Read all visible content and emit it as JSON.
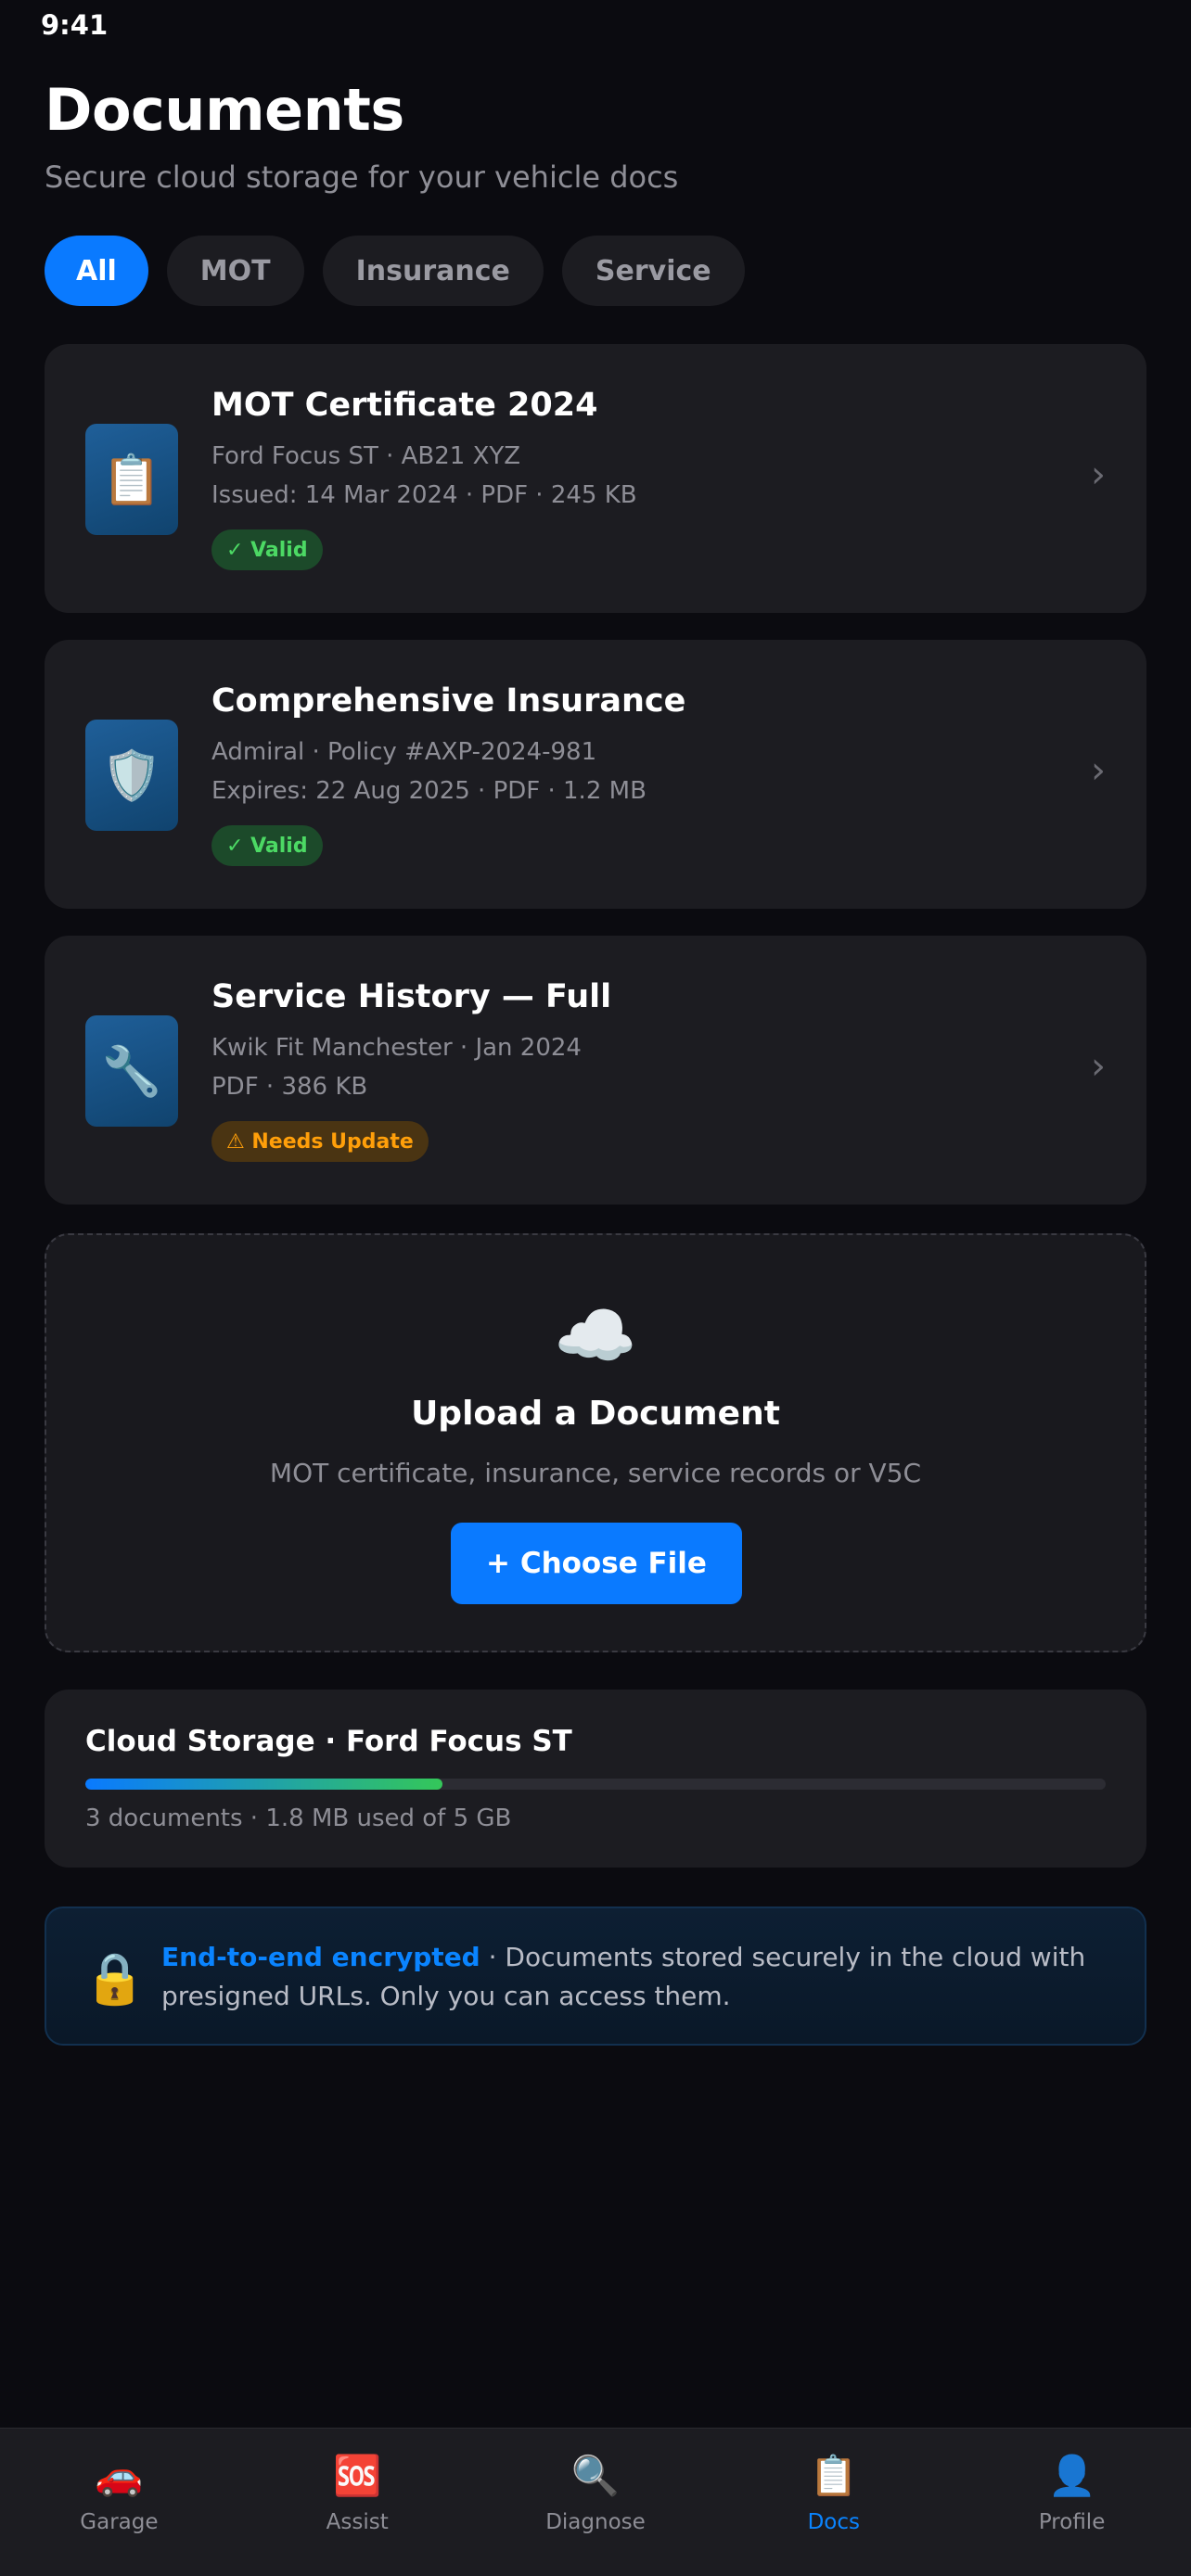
{
  "status_bar": {
    "time": "9:41"
  },
  "header": {
    "title": "Documents",
    "subtitle": "Secure cloud storage for your vehicle docs"
  },
  "filters": [
    {
      "label": "All",
      "active": true
    },
    {
      "label": "MOT",
      "active": false
    },
    {
      "label": "Insurance",
      "active": false
    },
    {
      "label": "Service",
      "active": false
    }
  ],
  "documents": [
    {
      "icon": "📋",
      "icon_name": "clipboard-icon",
      "title": "MOT Certificate 2024",
      "line1": "Ford Focus ST · AB21 XYZ",
      "line2": "Issued: 14 Mar 2024 · PDF · 245 KB",
      "badge": "✓ Valid",
      "badge_type": "valid"
    },
    {
      "icon": "🛡️",
      "icon_name": "shield-icon",
      "title": "Comprehensive Insurance",
      "line1": "Admiral · Policy #AXP-2024-981",
      "line2": "Expires: 22 Aug 2025 · PDF · 1.2 MB",
      "badge": "✓ Valid",
      "badge_type": "valid"
    },
    {
      "icon": "🔧",
      "icon_name": "wrench-icon",
      "title": "Service History — Full",
      "line1": "Kwik Fit Manchester · Jan 2024",
      "line2": "PDF · 386 KB",
      "badge": "⚠ Needs Update",
      "badge_type": "warn"
    }
  ],
  "chevron": "›",
  "upload": {
    "icon": "☁️",
    "title": "Upload a Document",
    "subtitle": "MOT certificate, insurance, service records or V5C",
    "button_label": "+ Choose File"
  },
  "storage": {
    "title": "Cloud Storage · Ford Focus ST",
    "summary": "3 documents · 1.8 MB used of 5 GB",
    "bar_fill_percent": 35
  },
  "security": {
    "icon": "🔒",
    "highlight": "End-to-end encrypted",
    "text": " · Documents stored securely in the cloud with presigned URLs. Only you can access them."
  },
  "tabs": [
    {
      "icon": "🚗",
      "icon_name": "car-icon",
      "label": "Garage",
      "active": false
    },
    {
      "icon": "🆘",
      "icon_name": "sos-icon",
      "label": "Assist",
      "active": false
    },
    {
      "icon": "🔍",
      "icon_name": "magnifier-icon",
      "label": "Diagnose",
      "active": false
    },
    {
      "icon": "📋",
      "icon_name": "clipboard-icon",
      "label": "Docs",
      "active": true
    },
    {
      "icon": "👤",
      "icon_name": "profile-icon",
      "label": "Profile",
      "active": false
    }
  ],
  "colors": {
    "accent": "#0a7aff",
    "valid": "#4cd964",
    "warning": "#ff9f0a",
    "background": "#0b0b10",
    "card": "#1c1c21"
  }
}
